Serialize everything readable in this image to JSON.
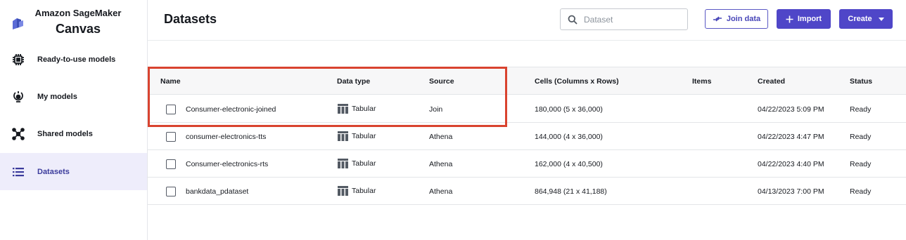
{
  "app": {
    "name_line1": "Amazon SageMaker",
    "name_line2": "Canvas",
    "logo_icon": "sagemaker-logo-icon"
  },
  "sidebar": {
    "items": [
      {
        "label": "Ready-to-use models",
        "icon": "chip-icon",
        "active": false
      },
      {
        "label": "My models",
        "icon": "brain-bulb-icon",
        "active": false
      },
      {
        "label": "Shared models",
        "icon": "share-network-icon",
        "active": false
      },
      {
        "label": "Datasets",
        "icon": "list-icon",
        "active": true
      }
    ]
  },
  "header": {
    "title": "Datasets",
    "search_placeholder": "Dataset",
    "join_label": "Join data",
    "import_label": "Import",
    "create_label": "Create"
  },
  "table": {
    "columns": [
      "Name",
      "Data type",
      "Source",
      "Cells (Columns x Rows)",
      "Items",
      "Created",
      "Status"
    ],
    "rows": [
      {
        "name": "Consumer-electronic-joined",
        "type": "Tabular",
        "source": "Join",
        "cells": "180,000 (5 x 36,000)",
        "items": "",
        "created": "04/22/2023 5:09 PM",
        "status": "Ready"
      },
      {
        "name": "consumer-electronics-tts",
        "type": "Tabular",
        "source": "Athena",
        "cells": "144,000 (4 x 36,000)",
        "items": "",
        "created": "04/22/2023 4:47 PM",
        "status": "Ready"
      },
      {
        "name": "Consumer-electronics-rts",
        "type": "Tabular",
        "source": "Athena",
        "cells": "162,000 (4 x 40,500)",
        "items": "",
        "created": "04/22/2023 4:40 PM",
        "status": "Ready"
      },
      {
        "name": "bankdata_pdataset",
        "type": "Tabular",
        "source": "Athena",
        "cells": "864,948 (21 x 41,188)",
        "items": "",
        "created": "04/13/2023 7:00 PM",
        "status": "Ready"
      }
    ]
  },
  "colors": {
    "accent": "#4f46c8",
    "active_bg": "#eeedfb",
    "highlight": "#d9432f"
  }
}
